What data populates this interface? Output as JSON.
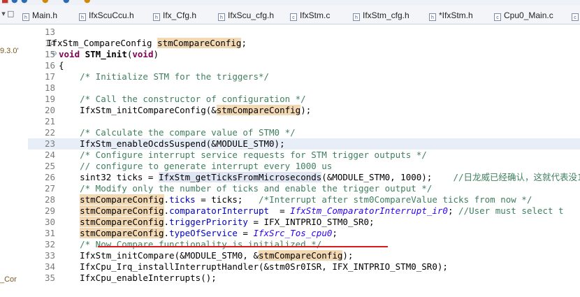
{
  "tabs": [
    {
      "label": "Main.h"
    },
    {
      "label": "IfxScuCcu.h"
    },
    {
      "label": "Ifx_Cfg.h"
    },
    {
      "label": "IfxScu_cfg.h"
    },
    {
      "label": "IfxStm.c"
    },
    {
      "label": "IfxStm_cfg.h"
    },
    {
      "label": "*IfxStm.h"
    },
    {
      "label": "Cpu0_Main.c"
    }
  ],
  "left_fragments": {
    "a": "9.3.0'",
    "b": "_Cor"
  },
  "lines": [
    {
      "n": "13"
    },
    {
      "n": "14"
    },
    {
      "n": "15"
    },
    {
      "n": "16"
    },
    {
      "n": "17"
    },
    {
      "n": "18"
    },
    {
      "n": "19"
    },
    {
      "n": "20"
    },
    {
      "n": "21"
    },
    {
      "n": "22"
    },
    {
      "n": "23"
    },
    {
      "n": "24"
    },
    {
      "n": "25"
    },
    {
      "n": "26"
    },
    {
      "n": "27"
    },
    {
      "n": "28"
    },
    {
      "n": "29"
    },
    {
      "n": "30"
    },
    {
      "n": "31"
    },
    {
      "n": "32"
    },
    {
      "n": "33"
    },
    {
      "n": "34"
    },
    {
      "n": "35"
    }
  ],
  "code": {
    "l14a": "IfxStm_CompareConfig ",
    "l14b": "stmCompareConfig",
    "l14c": ";",
    "l15kw": "void",
    "l15fn": " STM_init",
    "l15b": "(",
    "l15kw2": "void",
    "l15c": ")",
    "l16": "{",
    "l17": "    /* Initialize STM for the triggers*/",
    "l19": "    /* Call the constructor of configuration */",
    "l20a": "    IfxStm_initCompareConfig(&",
    "l20b": "stmCompareConfig",
    "l20c": ");",
    "l22": "    /* Calculate the compare value of STM0 */",
    "l23": "    IfxStm_enableOcdsSuspend(&MODULE_STM0);",
    "l24": "    /* Configure interrupt service requests for STM trigger outputs */",
    "l25": "    // configure to generate interrupt every 1000 us",
    "l26a": "    sint32 ticks = ",
    "l26b": "IfxStm_getTicksFromMicroseconds",
    "l26c": "(&MODULE_STM0, 1000);    ",
    "l26d": "//日龙威已经确认，这就代表没1",
    "l27": "    /* Modify only the number of ticks and enable the trigger output */",
    "l28a": "stmCompareConfig",
    "l28b": ".",
    "l28c": "ticks",
    "l28d": " = ticks;   ",
    "l28e": "/*Interrupt after stm0CompareValue ticks from now */",
    "l29a": "stmCompareConfig",
    "l29b": ".",
    "l29c": "comparatorInterrupt",
    "l29d": "  = ",
    "l29e": "IfxStm_ComparatorInterrupt_ir0",
    "l29f": "; ",
    "l29g": "//User must select t",
    "l30a": "stmCompareConfig",
    "l30b": ".",
    "l30c": "triggerPriority",
    "l30d": " = IFX_INTPRIO_STM0_SR0;",
    "l31a": "stmCompareConfig",
    "l31b": ".",
    "l31c": "typeOfService",
    "l31d": " = ",
    "l31e": "IfxSrc_Tos_cpu0",
    "l31f": ";",
    "l32": "    /* Now Compare functionality is initialized */",
    "l33a": "    IfxStm_initCompare(&MODULE_STM0, &",
    "l33b": "stmCompareConfig",
    "l33c": ");",
    "l34": "    IfxCpu_Irq_installInterruptHandler(&stm0Sr0ISR, IFX_INTPRIO_STM0_SR0);",
    "l35": "    IfxCpu_enableInterrupts();"
  },
  "colors": {
    "keyword": "#7f0055",
    "comment": "#3f7f5f",
    "constant": "#2a00ff",
    "field": "#0000c0",
    "occurrence": "#f2d9b3",
    "current_line": "#e8eef7",
    "error_underline": "#d81b1b"
  },
  "icons": [
    "file-h-icon",
    "file-c-icon",
    "fold-minus-icon",
    "bookmark-marker-icon",
    "minimize-icon",
    "maximize-icon"
  ]
}
